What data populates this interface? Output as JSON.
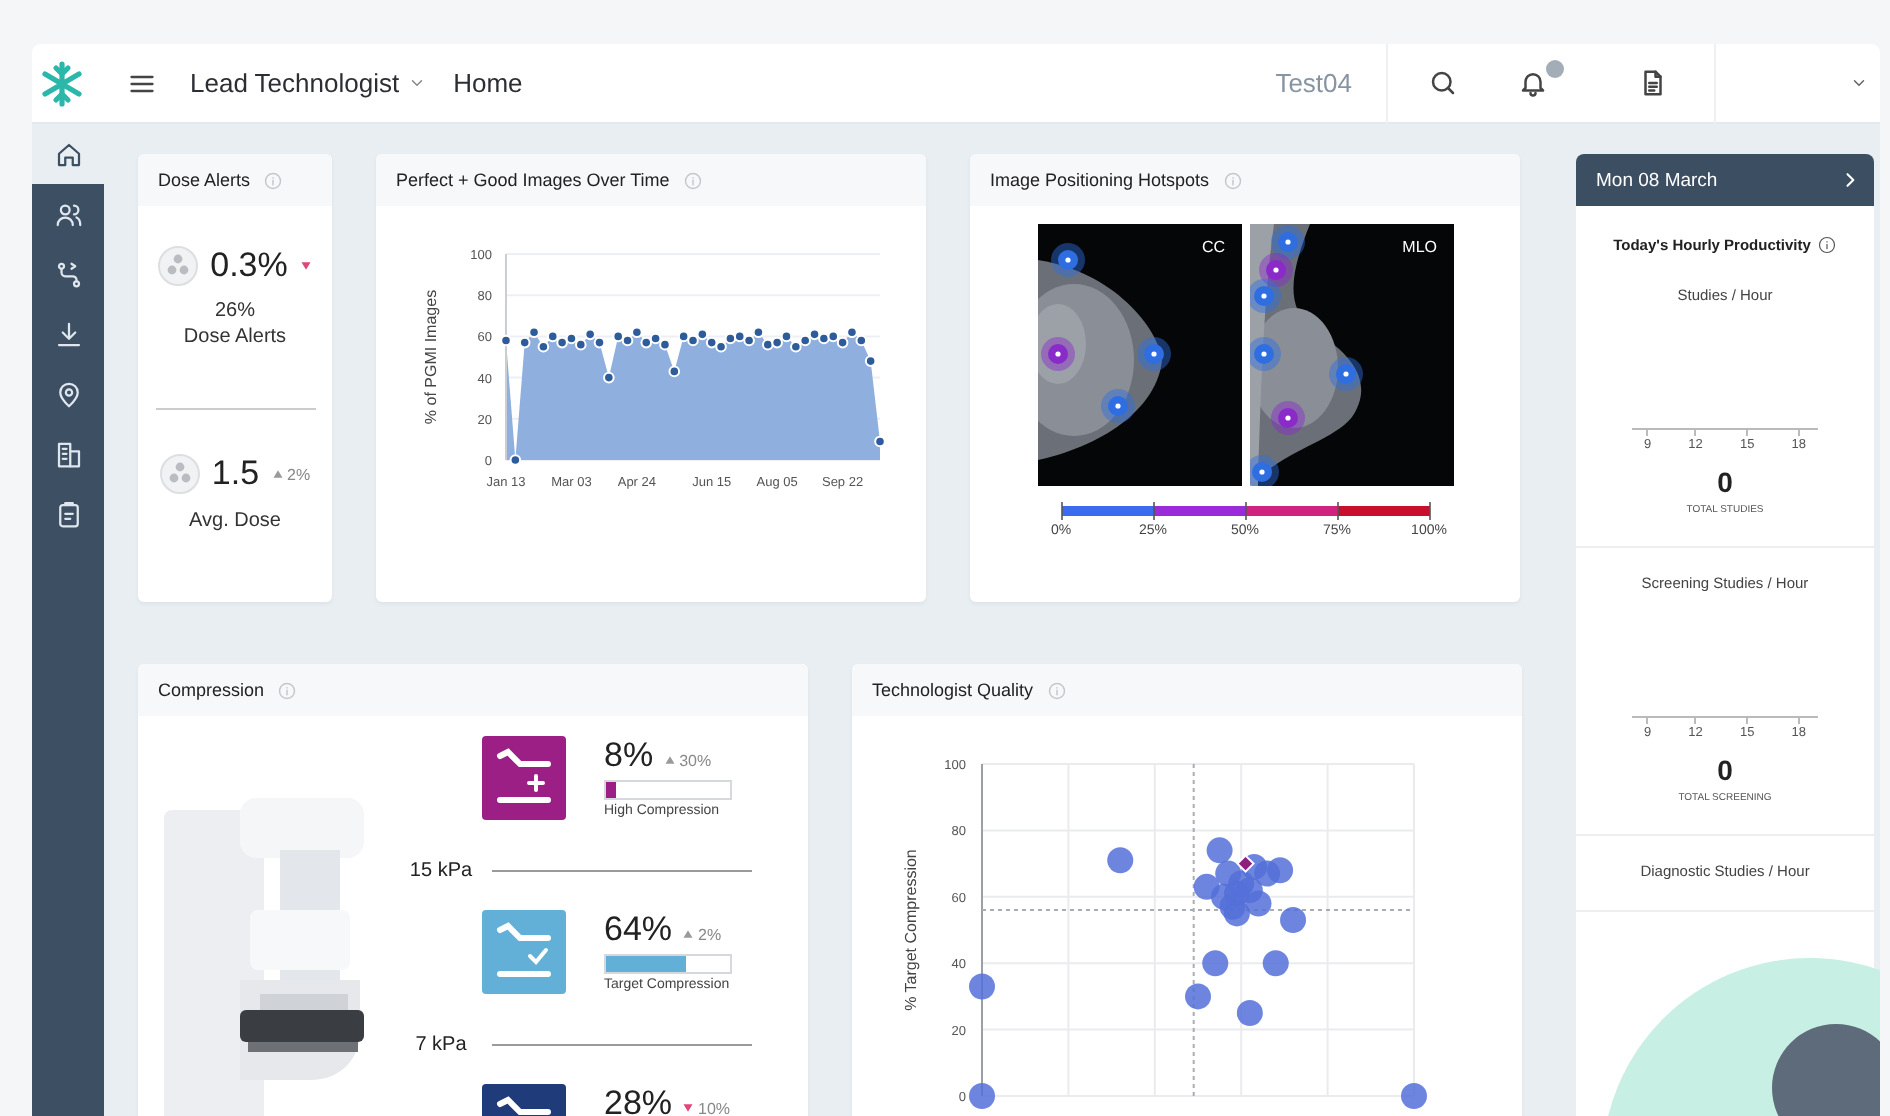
{
  "header": {
    "role": "Lead Technologist",
    "page": "Home",
    "user": "Test04"
  },
  "sidebar": {
    "items": [
      {
        "selected": true
      },
      {
        "selected": false
      },
      {
        "selected": false
      },
      {
        "selected": false
      },
      {
        "selected": false
      },
      {
        "selected": false
      },
      {
        "selected": false
      }
    ]
  },
  "dose_alerts": {
    "title": "Dose Alerts",
    "metrics": [
      {
        "value": "0.3%",
        "increase": false,
        "alert": true,
        "share": "26%",
        "label": "Dose Alerts"
      },
      {
        "value": "1.5",
        "increase": true,
        "alert": false,
        "change": "2%",
        "label": "Avg. Dose"
      }
    ]
  },
  "images_over_time": {
    "title": "Perfect + Good Images Over Time",
    "chart_data": {
      "type": "area",
      "ylabel": "% of PGMI Images",
      "categories": [
        "Jan 13",
        null,
        null,
        null,
        null,
        null,
        null,
        "Mar 03",
        null,
        null,
        null,
        null,
        null,
        null,
        "Apr 24",
        null,
        null,
        null,
        null,
        null,
        null,
        null,
        "Jun 15",
        null,
        null,
        null,
        null,
        null,
        null,
        "Aug 05",
        null,
        null,
        null,
        null,
        null,
        null,
        "Sep 22",
        null,
        null,
        null,
        null
      ],
      "series": [
        {
          "color": "#8fb0de",
          "values": [
            58,
            0,
            57,
            62,
            55,
            60,
            57,
            59,
            56,
            61,
            57,
            40,
            60,
            58,
            62,
            57,
            59,
            56,
            43,
            60,
            58,
            61,
            57,
            55,
            59,
            60,
            58,
            62,
            56,
            57,
            60,
            55,
            58,
            61,
            59,
            60,
            57,
            62,
            58,
            48,
            9
          ]
        }
      ],
      "ylim": [
        0,
        100
      ],
      "grid": true,
      "yticks": [
        0,
        20,
        40,
        60,
        80,
        100
      ]
    }
  },
  "positioning_hotspots": {
    "title": "Image Positioning Hotspots",
    "views": [
      {
        "label": "CC"
      },
      {
        "label": "MLO"
      }
    ],
    "scale": [
      "0%",
      "25%",
      "50%",
      "75%",
      "100%"
    ]
  },
  "compression": {
    "title": "Compression",
    "rows": [
      {
        "kind": "high",
        "color": "#9c1f86",
        "value": "8%",
        "increase": true,
        "alert": false,
        "change": "30%",
        "level": 0.08,
        "label": "High Compression"
      },
      {
        "kind": "target",
        "color": "#62b0d8",
        "value": "64%",
        "increase": true,
        "alert": false,
        "change": "2%",
        "level": 0.64,
        "label": "Target Compression"
      },
      {
        "kind": "low",
        "color": "#1f3b7a",
        "value": "28%",
        "increase": false,
        "alert": true,
        "change": "10%"
      }
    ],
    "thresholds": [
      "15 kPa",
      "7 kPa"
    ]
  },
  "technologist_quality": {
    "title": "Technologist Quality",
    "axis_title": "% Target Compression",
    "axis_ticks": [
      "100",
      "80",
      "60",
      "40",
      "20",
      "0"
    ]
  },
  "productivity": {
    "date": "Mon 08 March",
    "title": "Today's Hourly Productivity",
    "sections": [
      {
        "title": "Studies / Hour",
        "ticks": [
          "9",
          "12",
          "15",
          "18"
        ],
        "total": "0",
        "total_label": "TOTAL STUDIES"
      },
      {
        "title": "Screening Studies / Hour",
        "ticks": [
          "9",
          "12",
          "15",
          "18"
        ],
        "total": "0",
        "total_label": "TOTAL SCREENING"
      },
      {
        "title": "Diagnostic Studies / Hour"
      }
    ]
  }
}
